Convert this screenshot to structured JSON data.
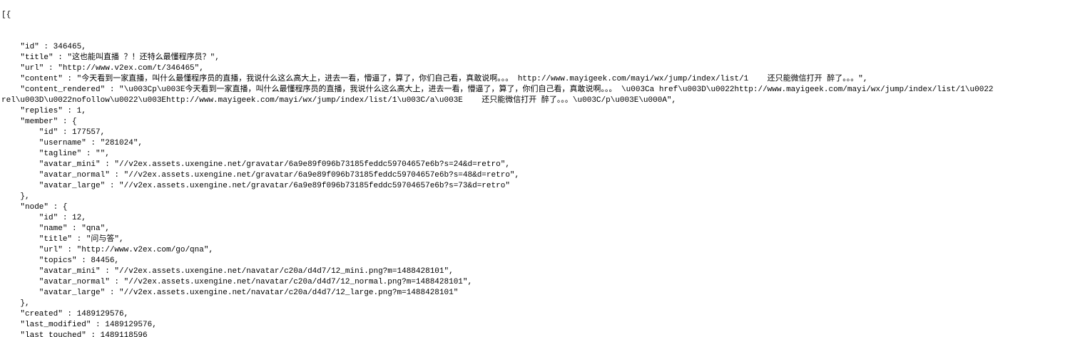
{
  "document": {
    "lines": [
      "[{",
      "",
      "",
      "    \"id\" : 346465,",
      "    \"title\" : \"这也能叫直播 ？！还特么最懂程序员？\",",
      "    \"url\" : \"http://www.v2ex.com/t/346465\",",
      "    \"content\" : \"今天看到一家直播，叫什么最懂程序员的直播，我说什么这么高大上，进去一看，懵逼了，算了，你们自己看，真敢说啊。。。 http://www.mayigeek.com/mayi/wx/jump/index/list/1    还只能微信打开 醉了。。。\",",
      "    \"content_rendered\" : \"\\u003Cp\\u003E今天看到一家直播，叫什么最懂程序员的直播，我说什么这么高大上，进去一看，懵逼了，算了，你们自己看，真敢说啊。。。 \\u003Ca href\\u003D\\u0022http://www.mayigeek.com/mayi/wx/jump/index/list/1\\u0022",
      "rel\\u003D\\u0022nofollow\\u0022\\u003Ehttp://www.mayigeek.com/mayi/wx/jump/index/list/1\\u003C/a\\u003E    还只能微信打开 醉了。。。\\u003C/p\\u003E\\u000A\",",
      "    \"replies\" : 1,",
      "    \"member\" : {",
      "        \"id\" : 177557,",
      "        \"username\" : \"281024\",",
      "        \"tagline\" : \"\",",
      "        \"avatar_mini\" : \"//v2ex.assets.uxengine.net/gravatar/6a9e89f096b73185feddc59704657e6b?s=24&d=retro\",",
      "        \"avatar_normal\" : \"//v2ex.assets.uxengine.net/gravatar/6a9e89f096b73185feddc59704657e6b?s=48&d=retro\",",
      "        \"avatar_large\" : \"//v2ex.assets.uxengine.net/gravatar/6a9e89f096b73185feddc59704657e6b?s=73&d=retro\"",
      "    },",
      "    \"node\" : {",
      "        \"id\" : 12,",
      "        \"name\" : \"qna\",",
      "        \"title\" : \"问与答\",",
      "        \"url\" : \"http://www.v2ex.com/go/qna\",",
      "        \"topics\" : 84456,",
      "        \"avatar_mini\" : \"//v2ex.assets.uxengine.net/navatar/c20a/d4d7/12_mini.png?m=1488428101\",",
      "        \"avatar_normal\" : \"//v2ex.assets.uxengine.net/navatar/c20a/d4d7/12_normal.png?m=1488428101\",",
      "        \"avatar_large\" : \"//v2ex.assets.uxengine.net/navatar/c20a/d4d7/12_large.png?m=1488428101\"",
      "    },",
      "    \"created\" : 1489129576,",
      "    \"last_modified\" : 1489129576,",
      "    \"last_touched\" : 1489118596"
    ]
  },
  "colors": {
    "background": "#ffffff",
    "text": "#000000"
  }
}
